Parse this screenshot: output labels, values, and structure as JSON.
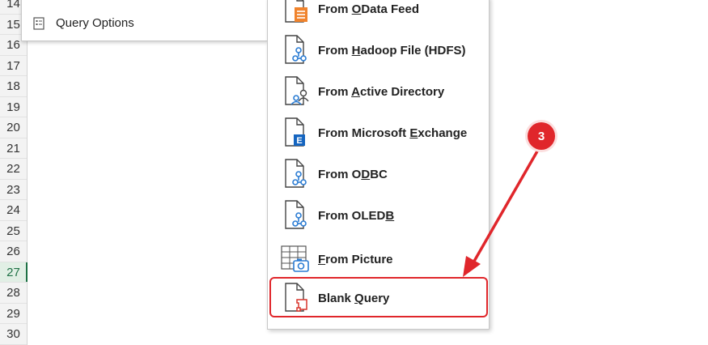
{
  "row_headers": {
    "rows": [
      "14",
      "15",
      "16",
      "17",
      "18",
      "19",
      "20",
      "21",
      "22",
      "23",
      "24",
      "25",
      "26",
      "27",
      "28",
      "29",
      "30"
    ],
    "active_row": "27"
  },
  "left_menu": {
    "query_options_label": "Query Options"
  },
  "submenu": {
    "items": [
      {
        "label_pre": "From ",
        "label_u": "O",
        "label_post": "Data Feed",
        "icon": "odata-feed-icon"
      },
      {
        "label_pre": "From ",
        "label_u": "H",
        "label_post": "adoop File (HDFS)",
        "icon": "hadoop-file-icon"
      },
      {
        "label_pre": "From ",
        "label_u": "A",
        "label_post": "ctive Directory",
        "icon": "active-directory-icon"
      },
      {
        "label_pre": "From Microsoft ",
        "label_u": "E",
        "label_post": "xchange",
        "icon": "exchange-icon"
      },
      {
        "label_pre": "From O",
        "label_u": "D",
        "label_post": "BC",
        "icon": "odbc-icon"
      },
      {
        "label_pre": "From OLED",
        "label_u": "B",
        "label_post": "",
        "icon": "oledb-icon"
      },
      {
        "label_pre": "",
        "label_u": "F",
        "label_post": "rom Picture",
        "icon": "picture-icon"
      },
      {
        "label_pre": "Blank ",
        "label_u": "Q",
        "label_post": "uery",
        "icon": "blank-query-icon"
      }
    ]
  },
  "step_badge": "3",
  "colors": {
    "accent_red": "#e0262b",
    "excel_green": "#1e7145",
    "icon_blue": "#2b7cd3",
    "odata_orange": "#f0832c"
  }
}
